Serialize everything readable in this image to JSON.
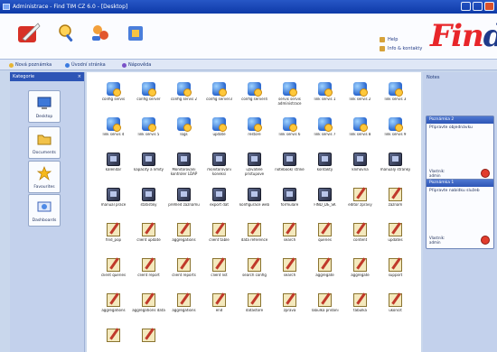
{
  "window": {
    "title": "Administrace - Find TIM CZ 6.0 - [Desktop]"
  },
  "toolbar": {
    "tools": [
      {
        "name": "tool-logo-icon"
      },
      {
        "name": "tool-search-icon"
      },
      {
        "name": "tool-users-icon"
      },
      {
        "name": "tool-settings-icon"
      }
    ],
    "links": [
      "Help",
      "Info & kontakty"
    ],
    "brand": {
      "main": "Fin",
      "tail": "d"
    }
  },
  "tabs": [
    {
      "label": "Nová poznámka",
      "color": "#e6b534"
    },
    {
      "label": "Úvodní stránka",
      "color": "#3b7be0"
    },
    {
      "label": "Nápověda",
      "color": "#7a52c7"
    }
  ],
  "sidebar": {
    "title": "Kategorie",
    "close": "×",
    "items": [
      "Desktop",
      "Documents",
      "Favourites",
      "Dashboards"
    ]
  },
  "main": {
    "items": [
      {
        "label": "config servis",
        "icon": "blue"
      },
      {
        "label": "config server",
        "icon": "blue"
      },
      {
        "label": "config servis 2",
        "icon": "blue"
      },
      {
        "label": "config server3",
        "icon": "blue"
      },
      {
        "label": "config server4",
        "icon": "blue"
      },
      {
        "label": "servis servis administrace",
        "icon": "blue"
      },
      {
        "label": "link servis 1",
        "icon": "blue"
      },
      {
        "label": "link servis 2",
        "icon": "blue"
      },
      {
        "label": "link servis 3",
        "icon": "blue"
      },
      {
        "label": "link servis 4",
        "icon": "blue"
      },
      {
        "label": "link servis 5",
        "icon": "blue"
      },
      {
        "label": "logs",
        "icon": "blue"
      },
      {
        "label": "update",
        "icon": "blue"
      },
      {
        "label": "restore",
        "icon": "blue"
      },
      {
        "label": "link servis 6",
        "icon": "blue"
      },
      {
        "label": "link servis 7",
        "icon": "blue"
      },
      {
        "label": "link servis 8",
        "icon": "blue"
      },
      {
        "label": "link servis 9",
        "icon": "blue"
      },
      {
        "label": "kalendar",
        "icon": "dark"
      },
      {
        "label": "kapacity a limity",
        "icon": "dark"
      },
      {
        "label": "Monitorovani kontroler LDAP",
        "icon": "dark"
      },
      {
        "label": "monitorovani koneksi",
        "icon": "dark"
      },
      {
        "label": "uzivatele pristupove",
        "icon": "dark"
      },
      {
        "label": "notebook/ strike",
        "icon": "dark"
      },
      {
        "label": "kontakty",
        "icon": "dark"
      },
      {
        "label": "knihovna",
        "icon": "dark"
      },
      {
        "label": "manualy stranky",
        "icon": "dark"
      },
      {
        "label": "manual prace",
        "icon": "dark"
      },
      {
        "label": "statistiky",
        "icon": "dark"
      },
      {
        "label": "prehled zaznamu",
        "icon": "dark"
      },
      {
        "label": "export dat",
        "icon": "dark"
      },
      {
        "label": "konfigurace web",
        "icon": "dark"
      },
      {
        "label": "formulare",
        "icon": "dark"
      },
      {
        "label": "FIND_DE_SK",
        "icon": "dark"
      },
      {
        "label": "editor zpravy",
        "icon": "edit"
      },
      {
        "label": "zaznam",
        "icon": "edit"
      },
      {
        "label": "find_pop",
        "icon": "edit"
      },
      {
        "label": "client update",
        "icon": "edit"
      },
      {
        "label": "aggregations",
        "icon": "edit"
      },
      {
        "label": "client table",
        "icon": "edit"
      },
      {
        "label": "data reference",
        "icon": "edit"
      },
      {
        "label": "search",
        "icon": "edit"
      },
      {
        "label": "queries",
        "icon": "edit"
      },
      {
        "label": "content",
        "icon": "edit"
      },
      {
        "label": "updates",
        "icon": "edit"
      },
      {
        "label": "client queries",
        "icon": "edit"
      },
      {
        "label": "client report",
        "icon": "edit"
      },
      {
        "label": "client reports",
        "icon": "edit"
      },
      {
        "label": "client list",
        "icon": "edit"
      },
      {
        "label": "search config",
        "icon": "edit"
      },
      {
        "label": "search",
        "icon": "edit"
      },
      {
        "label": "aggregate",
        "icon": "edit"
      },
      {
        "label": "aggregate",
        "icon": "edit"
      },
      {
        "label": "support",
        "icon": "edit"
      },
      {
        "label": "aggregations",
        "icon": "edit"
      },
      {
        "label": "aggregations data",
        "icon": "edit"
      },
      {
        "label": "aggregations",
        "icon": "edit"
      },
      {
        "label": "end",
        "icon": "edit"
      },
      {
        "label": "datastore",
        "icon": "edit"
      },
      {
        "label": "zprava",
        "icon": "edit"
      },
      {
        "label": "Tabulka pridani",
        "icon": "edit"
      },
      {
        "label": "tabulka",
        "icon": "edit"
      },
      {
        "label": "ukoncit",
        "icon": "edit"
      },
      {
        "label": "",
        "icon": "edit"
      },
      {
        "label": "",
        "icon": "edit"
      }
    ]
  },
  "notes": {
    "title": "Notes",
    "items": [
      {
        "header": "Poznámka 2",
        "body": "Připravte objednávku",
        "footer_line1": "Vlastník:",
        "footer_line2": "admin"
      },
      {
        "header": "Poznámka 1",
        "body": "Připravte nabídku služeb",
        "footer_line1": "Vlastník:",
        "footer_line2": "admin"
      }
    ]
  }
}
